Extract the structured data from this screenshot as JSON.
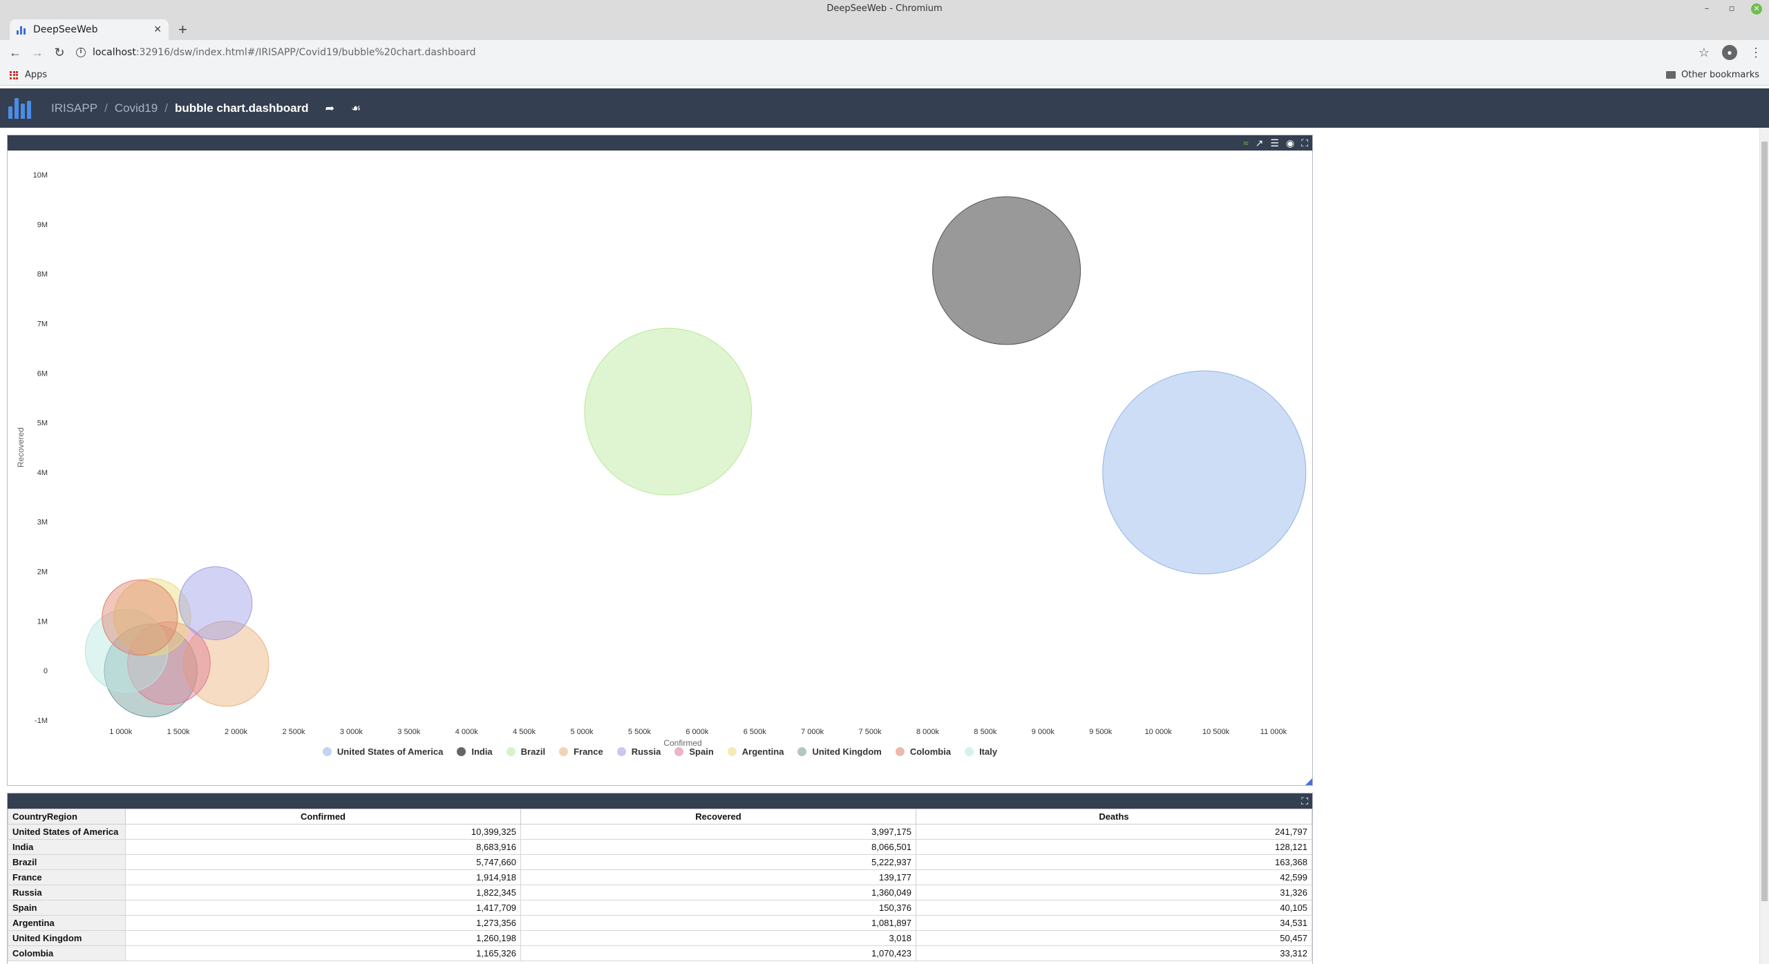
{
  "window": {
    "title": "DeepSeeWeb - Chromium"
  },
  "browser": {
    "tab_title": "DeepSeeWeb",
    "url_host": "localhost",
    "url_rest": ":32916/dsw/index.html#/IRISAPP/Covid19/bubble%20chart.dashboard",
    "bookmarks": {
      "apps": "Apps",
      "other": "Other bookmarks"
    }
  },
  "header": {
    "crumbs": [
      "IRISAPP",
      "Covid19",
      "bubble chart.dashboard"
    ]
  },
  "colors": {
    "header_bg": "#343f51",
    "accent": "#4b8de6"
  },
  "chart_data": {
    "type": "scatter",
    "bubble": true,
    "xlabel": "Confirmed",
    "ylabel": "Recovered",
    "xlim": [
      600000,
      11150000
    ],
    "ylim": [
      -1000000,
      10000000
    ],
    "x_ticks": [
      1000000,
      1500000,
      2000000,
      2500000,
      3000000,
      3500000,
      4000000,
      4500000,
      5000000,
      5500000,
      6000000,
      6500000,
      7000000,
      7500000,
      8000000,
      8500000,
      9000000,
      9500000,
      10000000,
      10500000,
      11000000
    ],
    "x_tick_labels": [
      "1 000k",
      "1 500k",
      "2 000k",
      "2 500k",
      "3 000k",
      "3 500k",
      "4 000k",
      "4 500k",
      "5 000k",
      "5 500k",
      "6 000k",
      "6 500k",
      "7 000k",
      "7 500k",
      "8 000k",
      "8 500k",
      "9 000k",
      "9 500k",
      "10 000k",
      "10 500k",
      "11 000k"
    ],
    "y_ticks": [
      -1000000,
      0,
      1000000,
      2000000,
      3000000,
      4000000,
      5000000,
      6000000,
      7000000,
      8000000,
      9000000,
      10000000
    ],
    "y_tick_labels": [
      "-1M",
      "0",
      "1M",
      "2M",
      "3M",
      "4M",
      "5M",
      "6M",
      "7M",
      "8M",
      "9M",
      "10M"
    ],
    "grid": false,
    "legend_position": "bottom",
    "series": [
      {
        "name": "United States of America",
        "x": 10399325,
        "y": 3997175,
        "size": 241797,
        "color": "#8fb3e8"
      },
      {
        "name": "India",
        "x": 8683916,
        "y": 8066501,
        "size": 128121,
        "color": "#555555"
      },
      {
        "name": "Brazil",
        "x": 5747660,
        "y": 5222937,
        "size": 163368,
        "color": "#b9e89a"
      },
      {
        "name": "France",
        "x": 1914918,
        "y": 139177,
        "size": 42599,
        "color": "#e8b27a"
      },
      {
        "name": "Russia",
        "x": 1822345,
        "y": 1360049,
        "size": 31326,
        "color": "#9c9ce8"
      },
      {
        "name": "Spain",
        "x": 1417709,
        "y": 150376,
        "size": 40105,
        "color": "#e07a92"
      },
      {
        "name": "Argentina",
        "x": 1273356,
        "y": 1081897,
        "size": 34531,
        "color": "#ecdb7a"
      },
      {
        "name": "United Kingdom",
        "x": 1260198,
        "y": 3018,
        "size": 50457,
        "color": "#6f9a9a"
      },
      {
        "name": "Colombia",
        "x": 1165326,
        "y": 1070423,
        "size": 33312,
        "color": "#e0806a"
      },
      {
        "name": "Italy",
        "x": 1050000,
        "y": 400000,
        "size": 40000,
        "color": "#b5e6e0"
      }
    ]
  },
  "table": {
    "headers": [
      "CountryRegion",
      "Confirmed",
      "Recovered",
      "Deaths"
    ],
    "rows": [
      [
        "United States of America",
        "10,399,325",
        "3,997,175",
        "241,797"
      ],
      [
        "India",
        "8,683,916",
        "8,066,501",
        "128,121"
      ],
      [
        "Brazil",
        "5,747,660",
        "5,222,937",
        "163,368"
      ],
      [
        "France",
        "1,914,918",
        "139,177",
        "42,599"
      ],
      [
        "Russia",
        "1,822,345",
        "1,360,049",
        "31,326"
      ],
      [
        "Spain",
        "1,417,709",
        "150,376",
        "40,105"
      ],
      [
        "Argentina",
        "1,273,356",
        "1,081,897",
        "34,531"
      ],
      [
        "United Kingdom",
        "1,260,198",
        "3,018",
        "50,457"
      ],
      [
        "Colombia",
        "1,165,326",
        "1,070,423",
        "33,312"
      ]
    ]
  }
}
